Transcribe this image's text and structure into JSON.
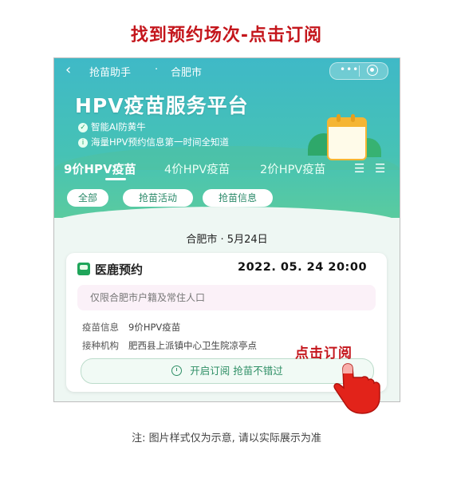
{
  "headline": "找到预约场次-点击订阅",
  "nav": {
    "back_icon": "back-chevron-icon",
    "title": "抢苗助手",
    "separator": "·",
    "city": "合肥市"
  },
  "hero": {
    "platform_title": "HPV疫苗服务平台",
    "features": [
      "智能AI防黄牛",
      "海量HPV预约信息第一时间全知道"
    ]
  },
  "tabs": [
    {
      "label": "9价HPV疫苗",
      "active": true
    },
    {
      "label": "4价HPV疫苗",
      "active": false
    },
    {
      "label": "2价HPV疫苗",
      "active": false
    }
  ],
  "filters": [
    "全部",
    "抢苗活动",
    "抢苗信息"
  ],
  "date_section": {
    "city": "合肥市",
    "dot": "·",
    "date": "5月24日"
  },
  "card": {
    "name": "医鹿预约",
    "datetime": "2022. 05. 24   20:00",
    "restriction": "仅限合肥市户籍及常住人口",
    "vaccine_label": "疫苗信息",
    "vaccine_value": "9价HPV疫苗",
    "institution_label": "接种机构",
    "institution_value": "肥西县上派镇中心卫生院凉亭点",
    "subscribe_button": "开启订阅 抢苗不错过"
  },
  "overlay_callout": "点击订阅",
  "note": "注: 图片样式仅为示意, 请以实际展示为准",
  "colors": {
    "accent_red": "#c4161c",
    "brand_teal": "#46c2b5",
    "brand_green": "#2f8f66"
  }
}
